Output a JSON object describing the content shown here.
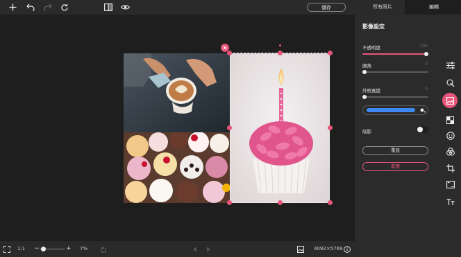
{
  "toolbar": {
    "save_label": "儲存",
    "tab_all_photos": "所有照片",
    "tab_edit": "編輯"
  },
  "panel": {
    "title": "影像設定",
    "opacity_label": "不透明度",
    "opacity_value": "100",
    "opacity_level": 1.0,
    "corner_label": "圓角",
    "corner_value": "0",
    "corner_level": 0,
    "border_label": "外框寬度",
    "border_value": "0",
    "border_level": 0,
    "border_color": "#3d8bf2",
    "shadow_label": "陰影",
    "shadow_on": false,
    "reset_label": "重設",
    "apply_label": "套用"
  },
  "bottom": {
    "fit_label": "1:1",
    "minus": "−",
    "plus": "+",
    "zoom_level": "7%",
    "dimensions": "4092×5769"
  },
  "colors": {
    "accent": "#e8557a",
    "panel_bg": "#2b2b2b",
    "canvas_bg": "#1e1e1e"
  },
  "icons": {
    "top": [
      "add-icon",
      "undo-icon",
      "redo-icon",
      "refresh-icon",
      "compare-icon",
      "preview-eye-icon"
    ],
    "side": [
      "adjust-sliders-icon",
      "magic-touch-icon",
      "image-settings-icon",
      "checker-icon",
      "sticker-smile-icon",
      "color-circles-icon",
      "crop-icon",
      "aspect-ratio-icon",
      "text-icon"
    ],
    "bottom": [
      "fit-screen-icon",
      "hand-pan-icon",
      "prev-arrow-icon",
      "next-arrow-icon",
      "image-icon",
      "info-icon"
    ]
  }
}
